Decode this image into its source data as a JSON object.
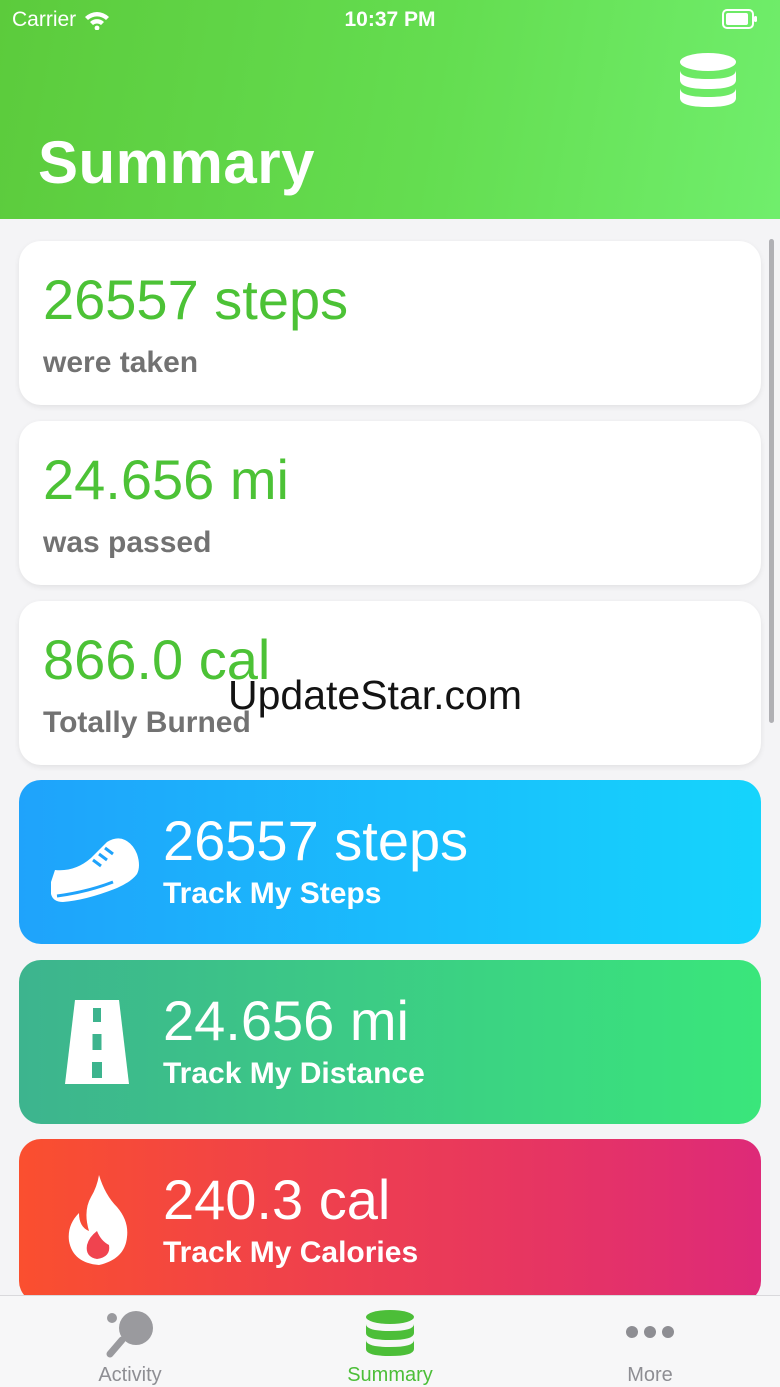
{
  "status_bar": {
    "carrier": "Carrier",
    "time": "10:37 PM"
  },
  "header": {
    "title": "Summary",
    "action_icon": "database-icon"
  },
  "summary_cards": [
    {
      "value": "26557 steps",
      "caption": "were taken"
    },
    {
      "value": "24.656 mi",
      "caption": "was passed"
    },
    {
      "value": "866.0 cal",
      "caption": "Totally Burned"
    }
  ],
  "track_cards": [
    {
      "icon": "sneaker-icon",
      "value": "26557 steps",
      "label": "Track My Steps"
    },
    {
      "icon": "road-icon",
      "value": "24.656 mi",
      "label": "Track My Distance"
    },
    {
      "icon": "flame-icon",
      "value": "240.3 cal",
      "label": "Track My Calories"
    }
  ],
  "watermark": "UpdateStar.com",
  "tabs": [
    {
      "label": "Activity",
      "icon": "ping-pong-icon",
      "active": false
    },
    {
      "label": "Summary",
      "icon": "database-icon",
      "active": true
    },
    {
      "label": "More",
      "icon": "more-dots-icon",
      "active": false
    }
  ],
  "colors": {
    "accent_green": "#4cc236",
    "caption_gray": "#727272",
    "steps_gradient": [
      "#1fa3fb",
      "#15d4fc"
    ],
    "distance_gradient": [
      "#3db48e",
      "#3ae67b"
    ],
    "calories_gradient": [
      "#fa4f2f",
      "#de2a78"
    ]
  }
}
